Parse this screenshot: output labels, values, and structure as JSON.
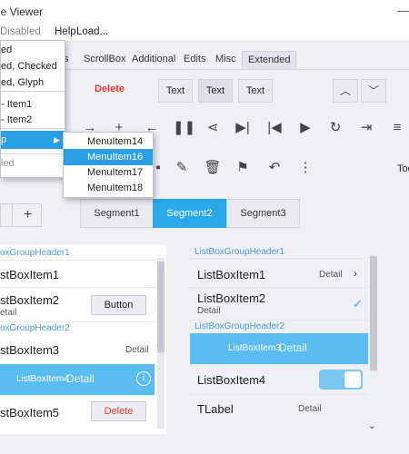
{
  "window": {
    "title": "le Viewer",
    "minimize_glyph": "—"
  },
  "menubar": {
    "items": [
      "Disabled",
      "Help",
      "Load..."
    ]
  },
  "tabs": [
    "s",
    "ScrollBox",
    "Additional",
    "Edits",
    "Misc",
    "Extended"
  ],
  "row1": {
    "delete_label": "Delete",
    "text_buttons": [
      "Text",
      "Text",
      "Text"
    ],
    "nav": [
      "chevron-up-icon",
      "chevron-down-icon"
    ]
  },
  "icons_row2": [
    "arrow-right-icon",
    "plus-icon",
    "arrow-left-icon",
    "pause-icon",
    "share-icon",
    "skip-next-icon",
    "skip-previous-icon",
    "play-icon",
    "refresh-icon",
    "exit-icon",
    "menu-icon"
  ],
  "icons_row3": [
    "edit-icon",
    "delete-icon",
    "bookmark-icon",
    "reply-icon",
    "more-vertical-icon"
  ],
  "row3_right_text": "Too",
  "segments": [
    "Segment1",
    "Segment2",
    "Segment3"
  ],
  "left_list": {
    "header1": "oxGroupHeader1",
    "item1": "stBoxItem1",
    "item2": "stBoxItem2",
    "item2_detail": "etail",
    "button_label": "Button",
    "header2": "oxGroupHeader2",
    "item3": "stBoxItem3",
    "item3_detail": "Detail",
    "item4": "ListBoxItem4",
    "item4_detail": "Detail",
    "item5": "stBoxItem5",
    "delete_label": "Delete"
  },
  "right_list": {
    "header1": "ListBoxGroupHeader1",
    "item1": "ListBoxItem1",
    "item1_detail": "Detail",
    "item2": "ListBoxItem2",
    "item2_detail": "Detail",
    "header2": "ListBoxGroupHeader2",
    "item3": "ListBoxItem3",
    "item3_detail": "Detail",
    "item4": "ListBoxItem4",
    "label": "TLabel",
    "label_detail": "Detail"
  },
  "menu1": {
    "items": [
      "ed",
      "ed, Checked",
      "ed, Glyph",
      "- Item1",
      "- Item2",
      "p",
      "led"
    ],
    "submenu_arrow": "▶"
  },
  "menu2": {
    "items": [
      "MenuItem14",
      "MenuItem16",
      "MenuItem17",
      "MenuItem18"
    ],
    "highlighted": "MenuItem16"
  },
  "colors": {
    "accent": "#29a8ea",
    "danger": "#e53935",
    "header_text": "#4f9ad8",
    "selection": "#5bbcf0"
  }
}
